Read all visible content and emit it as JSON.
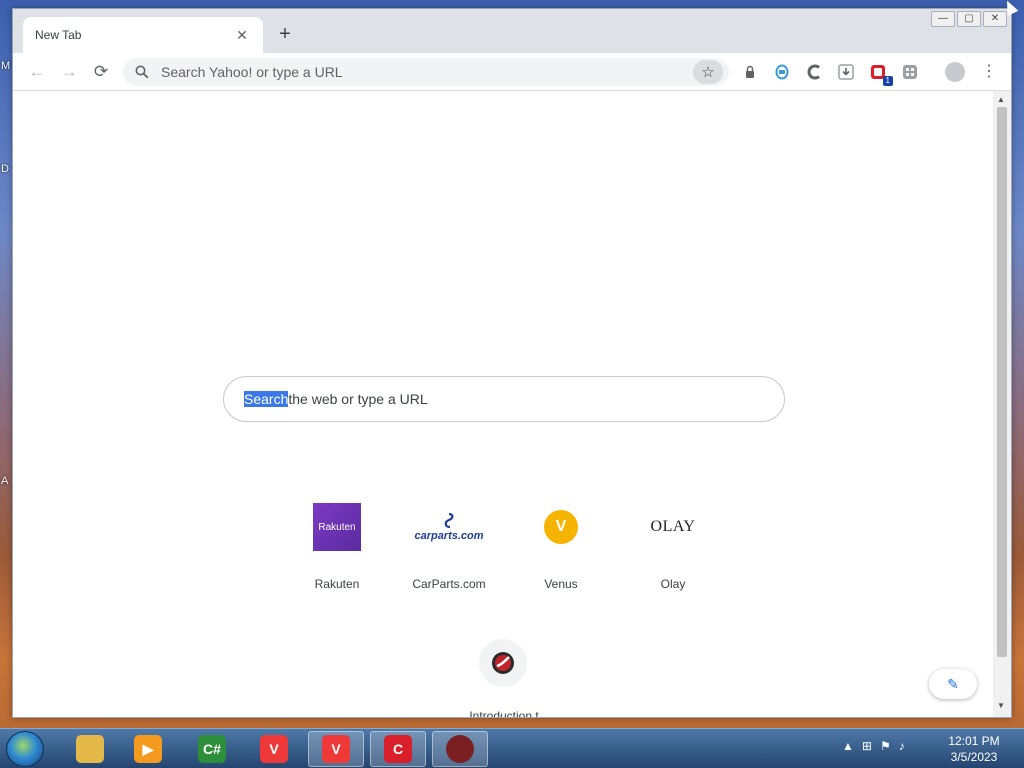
{
  "tab": {
    "title": "New Tab",
    "close_glyph": "✕",
    "new_tab_glyph": "+"
  },
  "window_controls": {
    "minimize": "—",
    "maximize": "▢",
    "close": "✕"
  },
  "toolbar": {
    "back_glyph": "←",
    "forward_glyph": "→",
    "reload_glyph": "⟳",
    "omnibox_placeholder": "Search Yahoo! or type a URL",
    "star_glyph": "☆",
    "extension_badge": "1",
    "menu_glyph": "⋮"
  },
  "ntp": {
    "search_selected": "Search",
    "search_rest": " the web or type a URL",
    "tiles": [
      {
        "label": "Rakuten",
        "icon_text": "Rakuten"
      },
      {
        "label": "CarParts.com",
        "icon_text": "carparts.com"
      },
      {
        "label": "Venus",
        "icon_text": "V"
      },
      {
        "label": "Olay",
        "icon_text": "OLAY"
      }
    ],
    "extra_label": "Introduction t",
    "edit_glyph": "✎"
  },
  "taskbar": {
    "apps": [
      {
        "name": "file-explorer",
        "label": "",
        "color": "#e5b84a"
      },
      {
        "name": "media-player",
        "label": "",
        "color": "#f39a1f"
      },
      {
        "name": "csharp-editor",
        "label": "C#",
        "color": "#2d8f3a"
      },
      {
        "name": "vivaldi",
        "label": "V",
        "color": "#ef3939"
      },
      {
        "name": "vivaldi-2",
        "label": "V",
        "color": "#ef3939"
      },
      {
        "name": "c-app",
        "label": "C",
        "color": "#d81f2a"
      },
      {
        "name": "comodo-browser",
        "label": "",
        "color": "#7a1f22"
      }
    ],
    "time": "12:01 PM",
    "date": "3/5/2023"
  },
  "desktop_letters": [
    "M",
    "D",
    "A"
  ]
}
